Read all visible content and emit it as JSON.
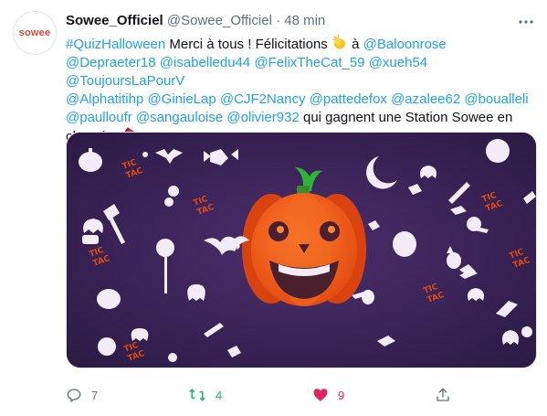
{
  "tweet": {
    "avatar_text": "sowee",
    "display_name": "Sowee_Officiel",
    "handle": "@Sowee_Officiel",
    "separator": "·",
    "time": "48 min",
    "text": {
      "hashtag": "#QuizHalloween",
      "part1": " Merci à tous ! Félicitations ",
      "part2": "  à ",
      "mention1": "@Baloonrose",
      "mentions_line2": "@Depraeter18 @isabelledu44 @FelixTheCat_59 @xueh54 @ToujoursLaPourV",
      "mentions_line3": "@Alphatitihp @GinieLap @CJF2Nancy @pattedefox @azalee62 @boualleli",
      "mentions_line4": "@paulloufr @sangauloise @olivier932",
      "part3": " qui gagnent une Station Sowee en",
      "part4": "chocolat "
    },
    "media": {
      "tic_tac": [
        "TIC",
        "TAC"
      ]
    }
  },
  "actions": {
    "reply_count": "7",
    "retweet_count": "4",
    "like_count": "9",
    "colors": {
      "retweet": "#17bf63",
      "like": "#e0245e",
      "icon": "#5b7083"
    }
  }
}
